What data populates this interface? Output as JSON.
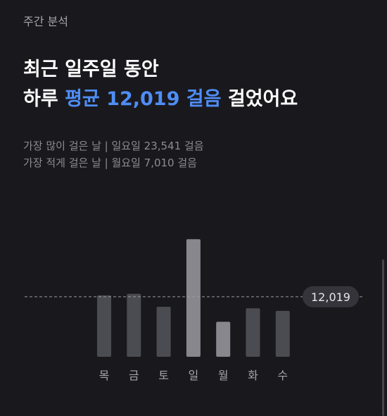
{
  "header": {
    "title": "주간 분석"
  },
  "headline": {
    "line1": "최근 일주일 동안",
    "line2_prefix": "하루 ",
    "line2_highlight": "평균 12,019 걸음",
    "line2_suffix": " 걸었어요"
  },
  "stats": {
    "max_day": "가장 많이 걸은 날 | 일요일 23,541 걸음",
    "min_day": "가장 적게 걸은 날 | 월요일 7,010 걸음"
  },
  "colors": {
    "background": "#19191d",
    "accent": "#4f8df5",
    "bar": "#4b4b52",
    "bar_highlight": "#87878d",
    "average_line": "#9a9aa0",
    "badge_bg": "#34343a"
  },
  "chart_data": {
    "type": "bar",
    "categories": [
      "목",
      "금",
      "토",
      "일",
      "월",
      "화",
      "수"
    ],
    "values": [
      12300,
      12600,
      10000,
      23541,
      7010,
      9700,
      9200
    ],
    "highlighted": [
      "일",
      "월"
    ],
    "average": 12019,
    "average_label": "12,019",
    "ylim": [
      0,
      24000
    ],
    "grid": false
  }
}
